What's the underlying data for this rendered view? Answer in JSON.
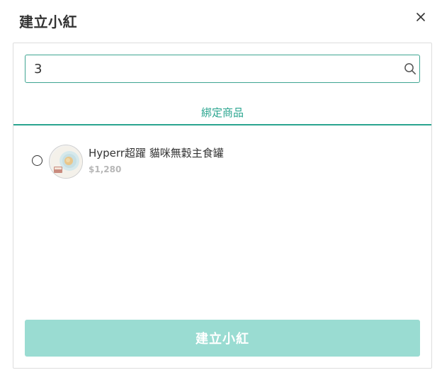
{
  "dialog": {
    "title": "建立小紅",
    "close_icon": "close-icon"
  },
  "search": {
    "value": "3",
    "placeholder": "",
    "icon": "search-icon"
  },
  "tabs": [
    {
      "label": "綁定商品",
      "active": true
    }
  ],
  "products": [
    {
      "name": "Hyperr超躍 貓咪無穀主食罐",
      "price": "$1,280",
      "selected": false,
      "image": "product-thumbnail"
    }
  ],
  "submit": {
    "label": "建立小紅",
    "enabled": false
  },
  "colors": {
    "accent": "#2aa58f",
    "search_border": "#3fa592",
    "submit_disabled_bg": "#9adcd2",
    "price_text": "#b7b7b7"
  }
}
